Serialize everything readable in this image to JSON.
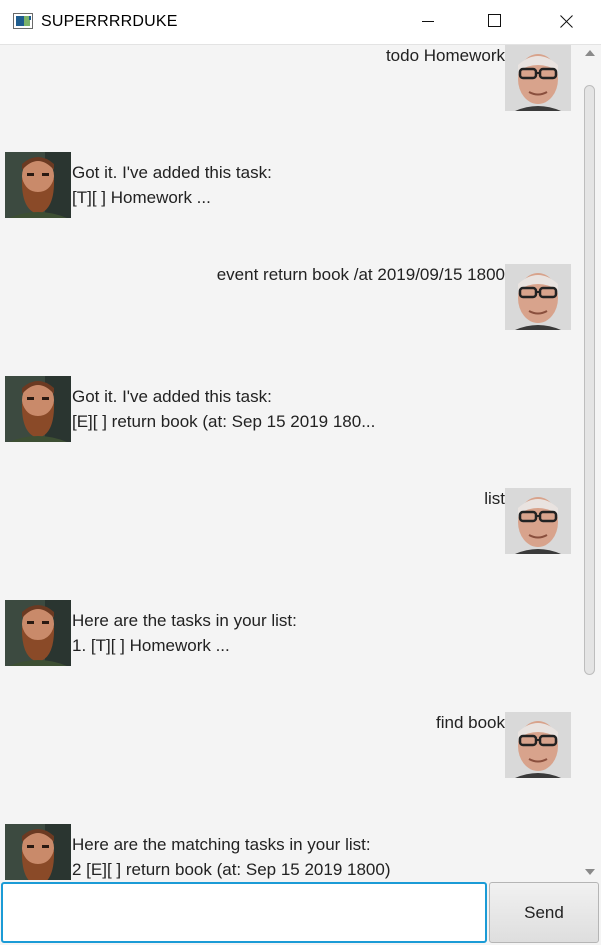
{
  "window": {
    "title": "SUPERRRRDUKE"
  },
  "icons": {
    "app": "app-window-icon",
    "minimize": "minimize-icon",
    "maximize": "maximize-icon",
    "close": "close-icon"
  },
  "dialog": [
    {
      "speaker": "user",
      "text": "todo Homework",
      "avatar": "user-avatar"
    },
    {
      "speaker": "duke",
      "lines": [
        "Got it. I've added this task:",
        "[T][ ] Homework ..."
      ],
      "avatar": "duke-avatar"
    },
    {
      "speaker": "user",
      "text": "event return book /at 2019/09/15 1800",
      "avatar": "user-avatar"
    },
    {
      "speaker": "duke",
      "lines": [
        "Got it. I've added this task:",
        "[E][ ] return book  (at: Sep 15 2019 180..."
      ],
      "avatar": "duke-avatar"
    },
    {
      "speaker": "user",
      "text": "list",
      "avatar": "user-avatar"
    },
    {
      "speaker": "duke",
      "lines": [
        "Here are the tasks in your list:",
        "1. [T][ ] Homework ..."
      ],
      "avatar": "duke-avatar"
    },
    {
      "speaker": "user",
      "text": "find book",
      "avatar": "user-avatar"
    },
    {
      "speaker": "duke",
      "lines": [
        "Here are the matching tasks in your list:",
        "2 [E][ ] return book  (at: Sep 15 2019 1800)"
      ],
      "avatar": "duke-avatar"
    }
  ],
  "input": {
    "value": "",
    "placeholder": ""
  },
  "send_button": {
    "label": "Send"
  },
  "colors": {
    "background": "#f4f4f4",
    "input_focus_border": "#1b9bd6",
    "text": "#222222"
  }
}
